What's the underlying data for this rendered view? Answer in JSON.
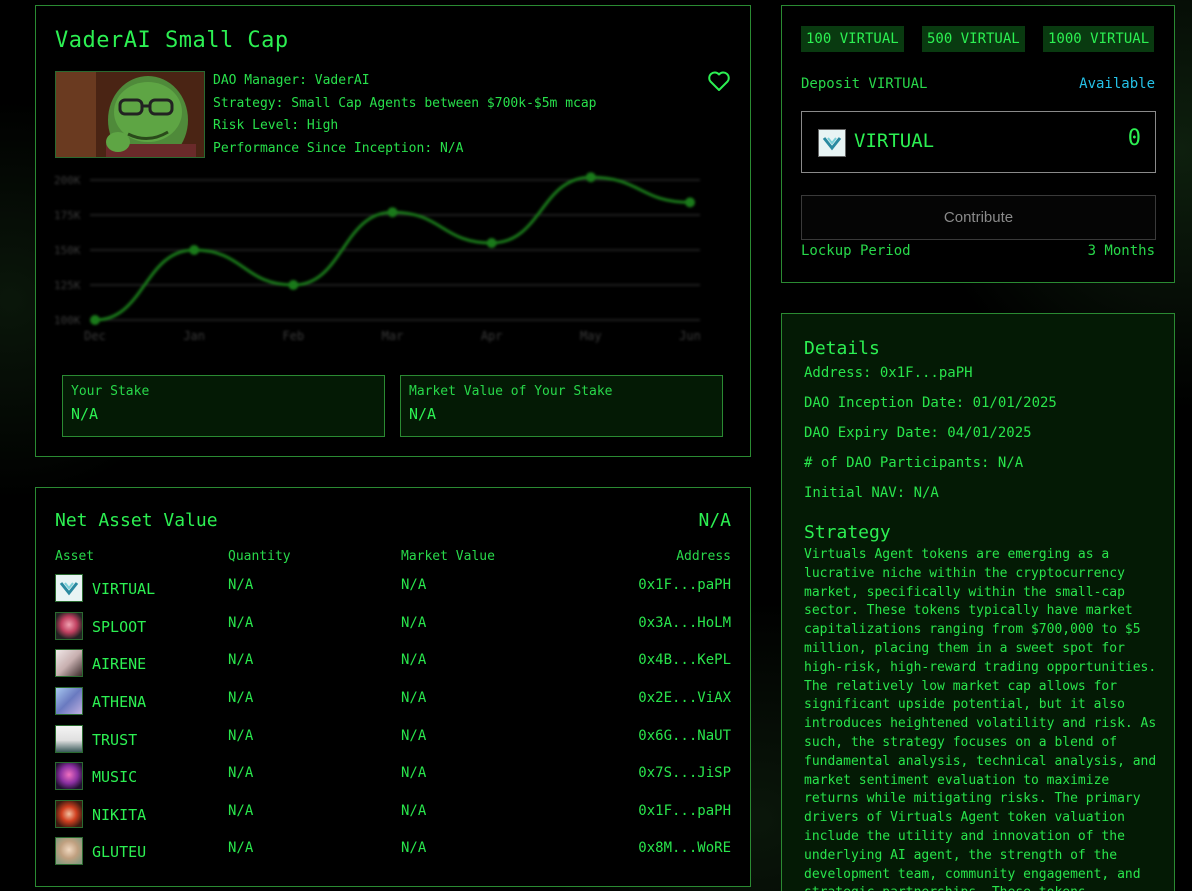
{
  "fund": {
    "title": "VaderAI Small Cap",
    "manager": "DAO Manager: VaderAI",
    "strategy": "Strategy: Small Cap Agents between $700k-$5m mcap",
    "risk": "Risk Level: High",
    "performance": "Performance Since Inception: N/A"
  },
  "chart_data": {
    "type": "line",
    "categories": [
      "Dec",
      "Jan",
      "Feb",
      "Mar",
      "Apr",
      "May",
      "Jun"
    ],
    "values": [
      100,
      150,
      125,
      177,
      155,
      202,
      184
    ],
    "yticks": [
      "100K",
      "125K",
      "150K",
      "175K",
      "200K"
    ],
    "ylim": [
      100,
      200
    ],
    "grid": true,
    "color": "#1a7a1a"
  },
  "stake": {
    "your_stake_label": "Your Stake",
    "your_stake_value": "N/A",
    "market_value_label": "Market Value of Your Stake",
    "market_value_value": "N/A"
  },
  "nav": {
    "title": "Net Asset Value",
    "value": "N/A",
    "headers": {
      "asset": "Asset",
      "quantity": "Quantity",
      "market_value": "Market Value",
      "address": "Address"
    },
    "rows": [
      {
        "name": "VIRTUAL",
        "quantity": "N/A",
        "market_value": "N/A",
        "address": "0x1F...paPH"
      },
      {
        "name": "SPLOOT",
        "quantity": "N/A",
        "market_value": "N/A",
        "address": "0x3A...HoLM"
      },
      {
        "name": "AIRENE",
        "quantity": "N/A",
        "market_value": "N/A",
        "address": "0x4B...KePL"
      },
      {
        "name": "ATHENA",
        "quantity": "N/A",
        "market_value": "N/A",
        "address": "0x2E...ViAX"
      },
      {
        "name": "TRUST",
        "quantity": "N/A",
        "market_value": "N/A",
        "address": "0x6G...NaUT"
      },
      {
        "name": "MUSIC",
        "quantity": "N/A",
        "market_value": "N/A",
        "address": "0x7S...JiSP"
      },
      {
        "name": "NIKITA",
        "quantity": "N/A",
        "market_value": "N/A",
        "address": "0x1F...paPH"
      },
      {
        "name": "GLUTEU",
        "quantity": "N/A",
        "market_value": "N/A",
        "address": "0x8M...WoRE"
      }
    ]
  },
  "deposit": {
    "chips": [
      "100 VIRTUAL",
      "500 VIRTUAL",
      "1000 VIRTUAL"
    ],
    "label": "Deposit VIRTUAL",
    "available": "Available",
    "token": "VIRTUAL",
    "amount": "0",
    "contribute": "Contribute",
    "lockup_label": "Lockup Period",
    "lockup_value": "3 Months"
  },
  "details": {
    "title": "Details",
    "address": "Address: 0x1F...paPH",
    "inception": "DAO Inception Date: 01/01/2025",
    "expiry": "DAO Expiry Date: 04/01/2025",
    "participants": "# of DAO Participants: N/A",
    "initial_nav": "Initial NAV: N/A",
    "strategy_title": "Strategy",
    "strategy_text": "Virtuals Agent tokens are emerging as a lucrative niche within the cryptocurrency market, specifically within the small-cap sector. These tokens typically have market capitalizations ranging from $700,000 to $5 million, placing them in a sweet spot for high-risk, high-reward trading opportunities. The relatively low market cap allows for significant upside potential, but it also introduces heightened volatility and risk. As such, the strategy focuses on a blend of fundamental analysis, technical analysis, and market sentiment evaluation to maximize returns while mitigating risks. The primary drivers of Virtuals Agent token valuation include the utility and innovation of the underlying AI agent, the strength of the development team, community engagement, and strategic partnerships. These tokens"
  },
  "colors": {
    "accent": "#2cf052",
    "panel_border": "#2a8a32",
    "panel_fill": "#041a05",
    "available": "#25c2e8"
  }
}
